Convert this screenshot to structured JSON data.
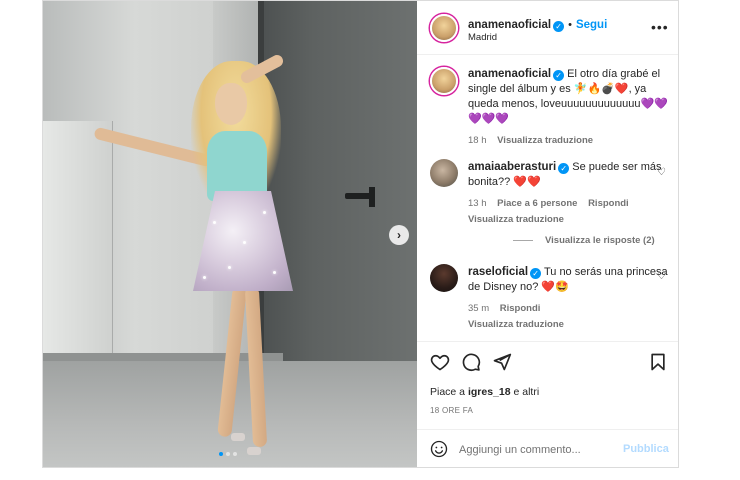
{
  "post": {
    "author": "anamenaoficial",
    "follow_label": "Segui",
    "separator": "•",
    "location": "Madrid",
    "more_icon": "more-horizontal-icon",
    "caption_author": "anamenaoficial",
    "caption_text": "El otro día grabé el single del álbum y es 🧚🔥💣❤️, ya queda menos, loveuuuuuuuuuuuuu💜💜💜💜💜",
    "caption_time": "18 h",
    "caption_translate": "Visualizza traduzione",
    "next_icon": "chevron-right-icon",
    "next_glyph": "›",
    "carousel": {
      "count": 3,
      "active_index": 0
    }
  },
  "comments": [
    {
      "author": "amaiaaberasturi",
      "text": "Se puede ser más bonita??",
      "hearts": "❤️❤️",
      "time": "13 h",
      "likes": "Piace a 6 persone",
      "reply": "Rispondi",
      "translate": "Visualizza traduzione",
      "view_replies": "Visualizza le risposte (2)"
    },
    {
      "author": "raseloficial",
      "text": "Tu no serás una princesa de Disney no?",
      "hearts": "❤️🤩",
      "time": "35 m",
      "reply": "Rispondi",
      "translate": "Visualizza traduzione"
    }
  ],
  "actions": {
    "like_icon": "heart-icon",
    "comment_icon": "comment-icon",
    "share_icon": "share-icon",
    "save_icon": "bookmark-icon",
    "likes_prefix": "Piace a ",
    "likes_user": "igres_18",
    "likes_suffix": " e altri",
    "posted_ago": "18 ORE FA"
  },
  "add_comment": {
    "emoji_icon": "smiley-icon",
    "placeholder": "Aggiungi un commento...",
    "publish_label": "Pubblica"
  },
  "colors": {
    "accent": "#0095f6",
    "publish_disabled": "#b3dbff",
    "heart_red": "#ed1b2f",
    "muted_text": "#737373",
    "primary_text": "#262626",
    "border": "#dbdbdb"
  }
}
